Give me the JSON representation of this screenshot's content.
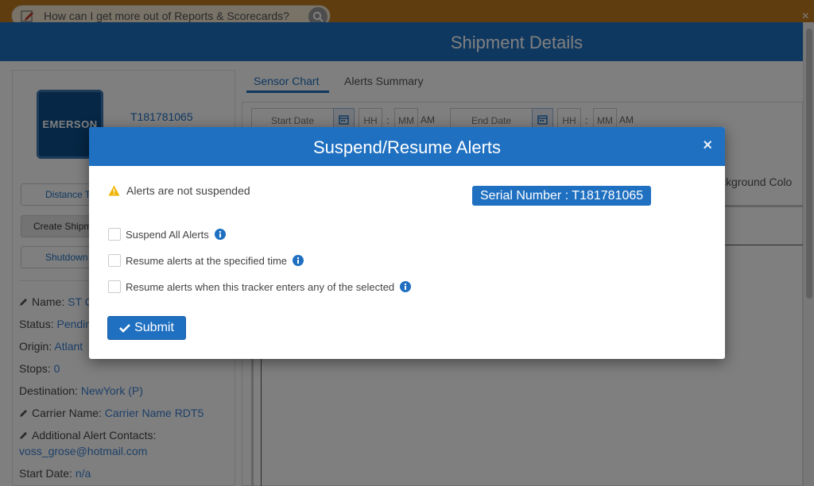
{
  "topbar": {
    "question": "How can I get more out of Reports & Scorecards?",
    "close_glyph": "×"
  },
  "window": {
    "title": "Shipment Details"
  },
  "left_panel": {
    "logo_text": "EMERSON",
    "tracker_id": "T181781065",
    "buttons": [
      "Distance T",
      "Create Shipm",
      "Shutdown"
    ],
    "fields": {
      "name_label": "Name:",
      "name_value": "ST C",
      "status_label": "Status:",
      "status_value": "Pendin",
      "origin_label": "Origin:",
      "origin_value": "Atlant",
      "stops_label": "Stops:",
      "stops_value": "0",
      "destination_label": "Destination:",
      "destination_value": "NewYork (P)",
      "carrier_label": "Carrier Name:",
      "carrier_value": "Carrier Name RDT5",
      "contacts_label": "Additional Alert Contacts:",
      "contacts_value": "voss_grose@hotmail.com",
      "start_date_label": "Start Date:",
      "start_date_value": "n/a"
    }
  },
  "tabs": [
    {
      "label": "Sensor Chart",
      "active": true
    },
    {
      "label": "Alerts Summary",
      "active": false
    }
  ],
  "chart_controls": {
    "start_placeholder": "Start Date",
    "end_placeholder": "End Date",
    "hh_placeholder": "HH",
    "mm_placeholder": "MM",
    "ampm": "AM",
    "colon": ":",
    "background_color_label": "ckground Colo"
  },
  "modal": {
    "title": "Suspend/Resume Alerts",
    "close_glyph": "×",
    "status_text": "Alerts are not suspended",
    "serial_badge": "Serial Number : T181781065",
    "options": [
      {
        "label": "Suspend All Alerts",
        "checked": false
      },
      {
        "label": "Resume alerts at the specified time",
        "checked": false
      },
      {
        "label": "Resume alerts when this tracker enters any of the selected",
        "checked": false
      }
    ],
    "submit_label": "Submit"
  },
  "colors": {
    "primary_blue": "#1f70c1",
    "topbar_orange": "#c07a1e",
    "warning_yellow": "#f0b400"
  },
  "icons": [
    "edit-icon",
    "search-icon",
    "calendar-icon",
    "pencil-icon",
    "warning-icon",
    "info-icon",
    "check-icon"
  ]
}
